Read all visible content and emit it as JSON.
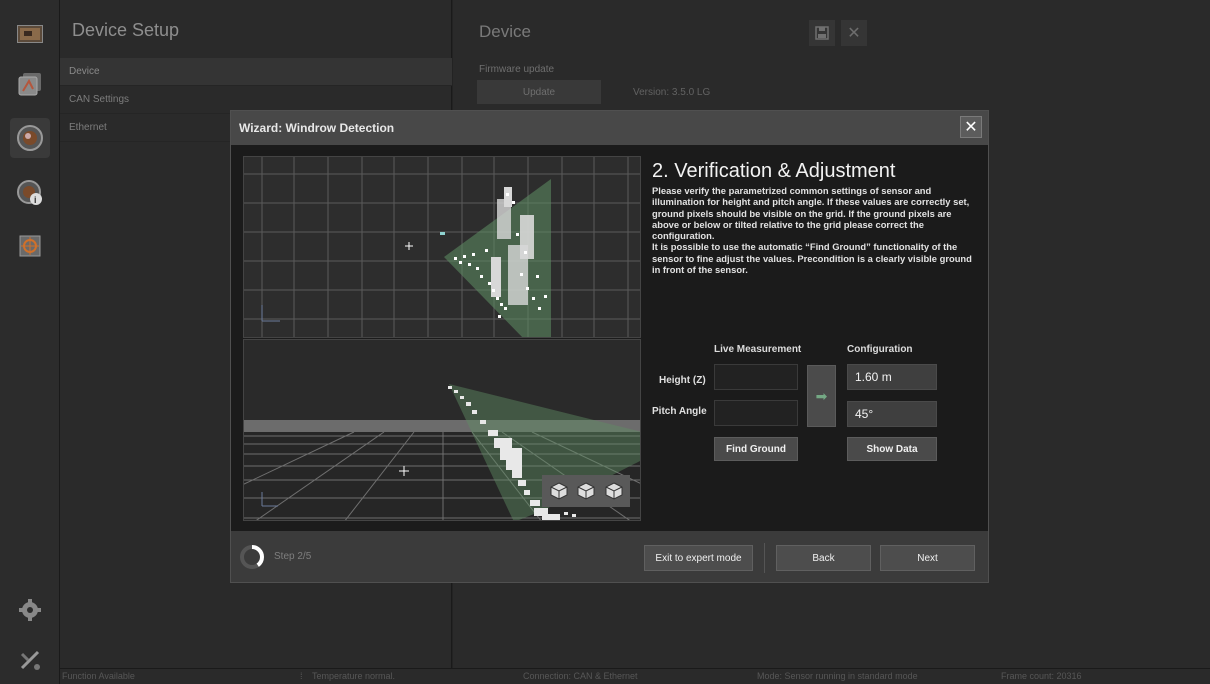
{
  "setup": {
    "title": "Device Setup",
    "items": [
      {
        "label": "Device",
        "active": true
      },
      {
        "label": "CAN Settings",
        "active": false
      },
      {
        "label": "Ethernet",
        "active": false
      }
    ]
  },
  "device": {
    "title": "Device",
    "firmware_label": "Firmware update",
    "update_button": "Update",
    "version": "Version: 3.5.0 LG"
  },
  "status_bar": {
    "function": "Function Available",
    "temperature": "Temperature normal.",
    "connection": "Connection: CAN & Ethernet",
    "mode": "Mode: Sensor running in standard mode",
    "frame_count": "Frame count: 20316"
  },
  "wizard": {
    "title": "Wizard: Windrow Detection",
    "close_glyph": "✕",
    "step_heading": "2. Verification & Adjustment",
    "description_1": "Please verify the parametrized common settings of sensor and illumination for height and pitch angle. If these values are correctly set, ground pixels should be visible on the grid. If the ground pixels are above or below or tilted relative to the grid please correct the configuration.",
    "description_2": "It is possible to use the automatic “Find Ground” functionality of the sensor to fine adjust the values. Precondition is a clearly visible ground in front of the sensor.",
    "live_header": "Live Measurement",
    "config_header": "Configuration",
    "height_label": "Height (Z)",
    "pitch_label": "Pitch Angle",
    "height_live": "",
    "pitch_live": "",
    "height_config": "1.60 m",
    "pitch_config": "45°",
    "arrow_glyph": "➡",
    "find_ground_button": "Find Ground",
    "show_data_button": "Show Data",
    "step_label": "Step 2/5",
    "step_progress": 0.4,
    "exit_button": "Exit to expert mode",
    "back_button": "Back",
    "next_button": "Next"
  },
  "colors": {
    "accent_green": "#6fa37b",
    "modal_header": "#484848",
    "body_dark": "#1b1b1b"
  }
}
